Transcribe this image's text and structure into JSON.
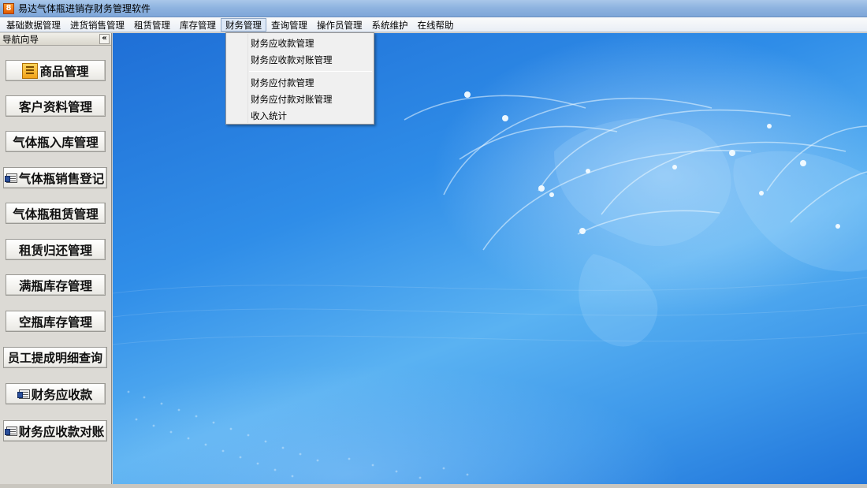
{
  "window": {
    "title": "易达气体瓶进销存财务管理软件",
    "icon_glyph": "8"
  },
  "menubar": {
    "items": [
      "基础数据管理",
      "进货销售管理",
      "租赁管理",
      "库存管理",
      "财务管理",
      "查询管理",
      "操作员管理",
      "系统维护",
      "在线帮助"
    ],
    "active": "财务管理"
  },
  "dropdown": {
    "group1": [
      "财务应收款管理",
      "财务应收款对账管理"
    ],
    "group2": [
      "财务应付款管理",
      "财务应付款对账管理",
      "收入统计"
    ]
  },
  "nav": {
    "header": "导航向导",
    "collapse_glyph": "«",
    "buttons": [
      "商品管理",
      "客户资料管理",
      "气体瓶入库管理",
      "气体瓶销售登记",
      "气体瓶租赁管理",
      "租赁归还管理",
      "满瓶库存管理",
      "空瓶库存管理",
      "员工提成明细查询",
      "财务应收款",
      "财务应收款对账"
    ]
  },
  "colors": {
    "background_blue": "#2f8de8",
    "menu_active": "#dde8f6"
  }
}
